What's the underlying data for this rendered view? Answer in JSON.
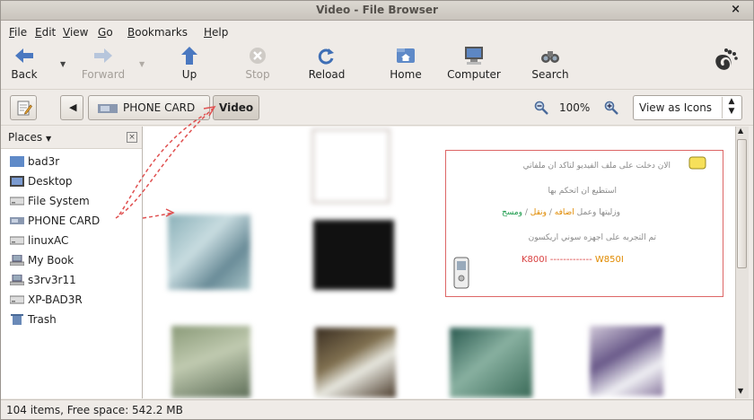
{
  "window": {
    "title": "Video - File Browser",
    "close_glyph": "×"
  },
  "menu": [
    {
      "accel": "F",
      "rest": "ile"
    },
    {
      "accel": "E",
      "rest": "dit"
    },
    {
      "accel": "V",
      "rest": "iew"
    },
    {
      "accel": "G",
      "rest": "o"
    },
    {
      "accel": "B",
      "rest": "ookmarks"
    },
    {
      "accel": "H",
      "rest": "elp"
    }
  ],
  "toolbar": {
    "back": "Back",
    "forward": "Forward",
    "up": "Up",
    "stop": "Stop",
    "reload": "Reload",
    "home": "Home",
    "computer": "Computer",
    "search": "Search"
  },
  "location": {
    "device": "PHONE CARD",
    "folder": "Video",
    "zoom": "100%",
    "view_mode": "View as Icons"
  },
  "sidebar": {
    "header": "Places",
    "items": [
      "bad3r",
      "Desktop",
      "File System",
      "PHONE CARD",
      "linuxAC",
      "My Book",
      "s3rv3r11",
      "XP-BAD3R",
      "Trash"
    ]
  },
  "infobox": {
    "line1": "الان دخلت على ملف الفيديو لتاكد ان ملفاتي",
    "line2": "استطيع ان اتحكم بها",
    "line3_a": "وزليتها وعمل ",
    "line3_b": "اضافه",
    "line3_sep1": " / ",
    "line3_c": "ونقل",
    "line3_sep2": " / ",
    "line3_d": "ومسح",
    "line4": "تم التجربه على اجهزه سوني اريكسون",
    "model_a": "K800I",
    "model_dash": " ------------- ",
    "model_b": "W850I"
  },
  "status": {
    "text": "104 items, Free space: 542.2 MB"
  },
  "colors": {
    "accent_red": "#e04040",
    "arrow_red": "#e05050",
    "green": "#1a9a4a",
    "orange": "#e08a00"
  }
}
